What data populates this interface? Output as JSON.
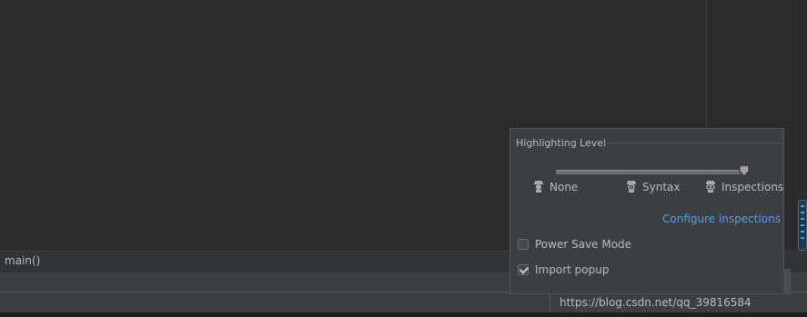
{
  "editor": {
    "breadcrumb": "main()"
  },
  "status_bar": {
    "text": "https://blog.csdn.net/qq_39816584"
  },
  "popup": {
    "title": "Highlighting Level",
    "slider": {
      "selected_level": "Inspections",
      "value_fraction": 1.0
    },
    "levels": [
      {
        "label": "None",
        "icon": "none-level-icon"
      },
      {
        "label": "Syntax",
        "icon": "syntax-level-icon"
      },
      {
        "label": "Inspections",
        "icon": "inspections-level-icon"
      }
    ],
    "configure_link": "Configure inspections",
    "options": [
      {
        "label": "Power Save Mode",
        "checked": false
      },
      {
        "label": "Import popup",
        "checked": true
      }
    ]
  },
  "colors": {
    "editor_bg": "#2b2b2b",
    "popup_bg": "#3c3f41",
    "link": "#589df6",
    "text": "#bbbbbb"
  }
}
